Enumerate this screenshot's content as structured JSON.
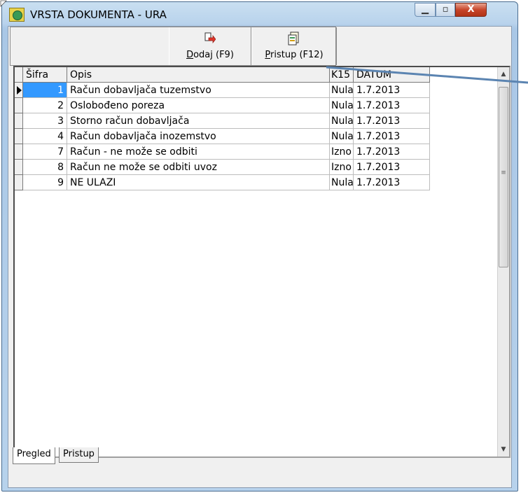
{
  "window": {
    "title": "VRSTA DOKUMENTA - URA",
    "minimize_glyph": "▁",
    "maximize_glyph": "▫",
    "close_glyph": "X"
  },
  "toolbar": {
    "dodaj_label_accel": "D",
    "dodaj_label_rest": "odaj (F9)",
    "pristup_label_accel": "P",
    "pristup_label_rest": "ristup (F12)"
  },
  "grid": {
    "columns": [
      "Šifra",
      "Opis",
      "K15",
      "DATUM"
    ],
    "rows": [
      {
        "sifra": "1",
        "opis": "Račun dobavljača tuzemstvo",
        "k15": "Nula",
        "datum": "1.7.2013"
      },
      {
        "sifra": "2",
        "opis": "Oslobođeno poreza",
        "k15": "Nula",
        "datum": "1.7.2013"
      },
      {
        "sifra": "3",
        "opis": "Storno račun dobavljača",
        "k15": "Nula",
        "datum": "1.7.2013"
      },
      {
        "sifra": "4",
        "opis": "Račun dobavljača inozemstvo",
        "k15": "Nula",
        "datum": "1.7.2013"
      },
      {
        "sifra": "7",
        "opis": "Račun - ne može se odbiti",
        "k15": "Izno",
        "datum": "1.7.2013"
      },
      {
        "sifra": "8",
        "opis": "Račun  ne može se odbiti uvoz",
        "k15": "Izno",
        "datum": "1.7.2013"
      },
      {
        "sifra": "9",
        "opis": "NE ULAZI",
        "k15": "Nula",
        "datum": "1.7.2013"
      }
    ],
    "selected_row": 0
  },
  "tabs": [
    "Pregled",
    "Pristup"
  ],
  "colors": {
    "selection": "#3399ff",
    "annotation_line": "#5b84b1"
  }
}
